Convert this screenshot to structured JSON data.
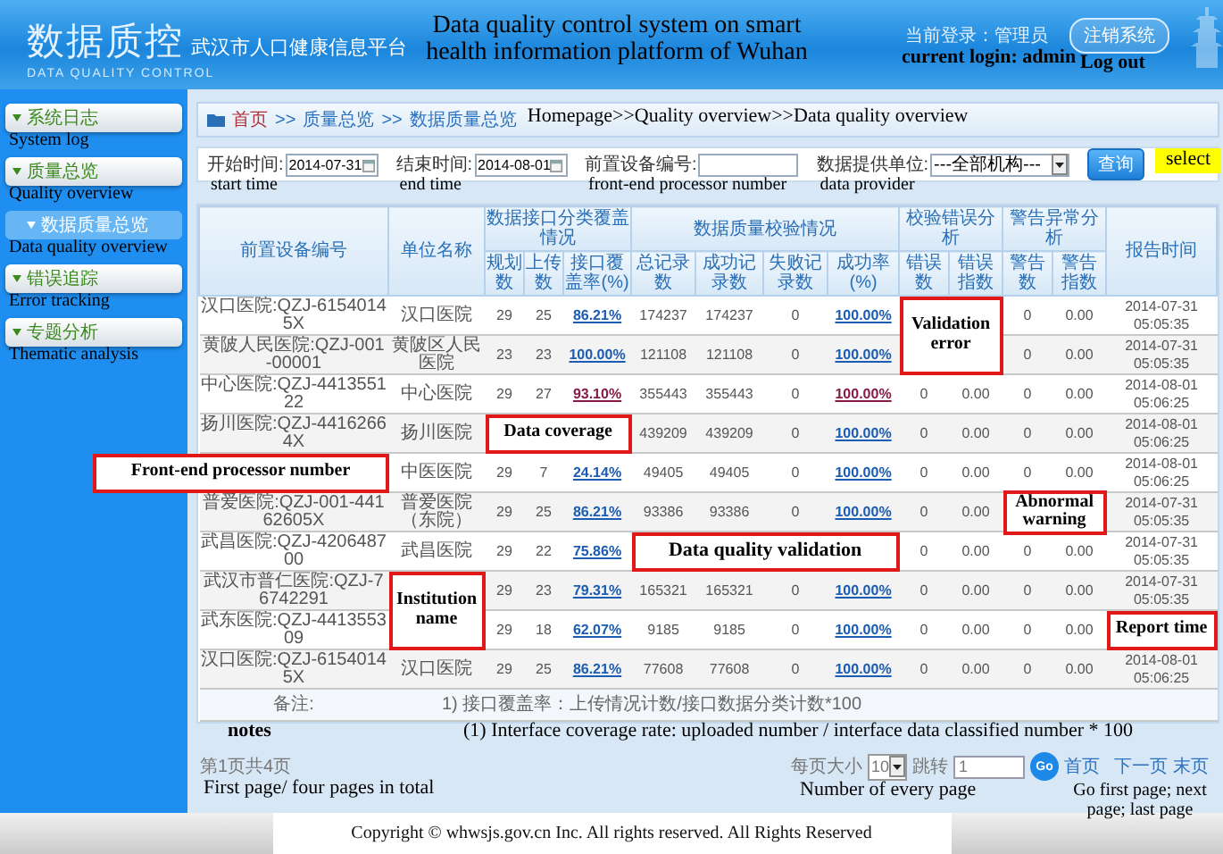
{
  "header": {
    "logo_title": "数据质控",
    "platform": "武汉市人口健康信息平台",
    "logo_subtitle": "DATA QUALITY CONTROL",
    "current_login": "当前登录：管理员",
    "logout": "注销系统"
  },
  "sidebar": {
    "items": [
      {
        "label": "系统日志",
        "selected": false
      },
      {
        "label": "质量总览",
        "selected": false,
        "children": [
          {
            "label": "数据质量总览",
            "selected": true
          }
        ]
      },
      {
        "label": "错误追踪",
        "selected": false
      },
      {
        "label": "专题分析",
        "selected": false
      }
    ]
  },
  "breadcrumb": {
    "items": [
      "首页",
      "质量总览",
      "数据质量总览"
    ],
    "separator": ">>"
  },
  "filters": [
    {
      "label": "开始时间:",
      "value": "2014-07-31",
      "kind": "date"
    },
    {
      "label": "结束时间:",
      "value": "2014-08-01",
      "kind": "date"
    },
    {
      "label": "前置设备编号:",
      "kind": "text"
    },
    {
      "label": "数据提供单位:",
      "value": "---全部机构---",
      "kind": "select"
    }
  ],
  "query_button": "查询",
  "table": {
    "header": [
      {
        "label": "前置设备编号"
      },
      {
        "label": "单位名称"
      },
      {
        "label": "数据接口分类覆盖情况",
        "sub": [
          "规划数",
          "上传数",
          "接口覆盖率(%)"
        ]
      },
      {
        "label": "数据质量校验情况",
        "sub": [
          "总记录数",
          "成功记录数",
          "失败记录数",
          "成功率(%)"
        ]
      },
      {
        "label": "校验错误分析",
        "sub": [
          "错误数",
          "错误指数"
        ]
      },
      {
        "label": "警告异常分析",
        "sub": [
          "警告数",
          "警告指数"
        ]
      },
      {
        "label": "报告时间"
      }
    ],
    "rows": [
      {
        "visited": false,
        "cells": [
          "汉口医院:QZJ-61540145X",
          "汉口医院",
          "29",
          "25",
          "86.21%",
          "174237",
          "174237",
          "0",
          "100.00%",
          null,
          null,
          "0",
          "0.00",
          "2014-07-31 05:05:35"
        ]
      },
      {
        "visited": false,
        "cells": [
          "黄陂人民医院:QZJ-001-00001",
          "黄陂区人民医院",
          "23",
          "23",
          "100.00%",
          "121108",
          "121108",
          "0",
          "100.00%",
          null,
          null,
          "0",
          "0.00",
          "2014-07-31 05:05:35"
        ]
      },
      {
        "visited": true,
        "cells": [
          "中心医院:QZJ-441355122",
          "中心医院",
          "29",
          "27",
          "93.10%",
          "355443",
          "355443",
          "0",
          "100.00%",
          "0",
          "0.00",
          "0",
          "0.00",
          "2014-08-01 05:06:25"
        ]
      },
      {
        "visited": false,
        "cells": [
          "扬川医院:QZJ-44162664X",
          "扬川医院",
          null,
          null,
          null,
          "439209",
          "439209",
          "0",
          "100.00%",
          "0",
          "0.00",
          "0",
          "0.00",
          "2014-08-01 05:06:25"
        ]
      },
      {
        "visited": false,
        "cells": [
          null,
          "中医医院",
          "29",
          "7",
          "24.14%",
          "49405",
          "49405",
          "0",
          "100.00%",
          "0",
          "0.00",
          "0",
          "0.00",
          "2014-08-01 05:06:25"
        ]
      },
      {
        "visited": false,
        "cells": [
          "普爱医院:QZJ-001-44162605X",
          "普爱医院（东院）",
          "29",
          "25",
          "86.21%",
          "93386",
          "93386",
          "0",
          "100.00%",
          "0",
          "0.00",
          null,
          null,
          "2014-07-31 05:05:35"
        ]
      },
      {
        "visited": false,
        "cells": [
          "武昌医院:QZJ-420648700",
          "武昌医院",
          "29",
          "22",
          "75.86%",
          null,
          null,
          null,
          null,
          "0",
          "0.00",
          "0",
          "0.00",
          "2014-07-31 05:05:35"
        ]
      },
      {
        "visited": false,
        "cells": [
          "武汉市普仁医院:QZJ-76742291",
          null,
          "29",
          "23",
          "79.31%",
          "165321",
          "165321",
          "0",
          "100.00%",
          "0",
          "0.00",
          "0",
          "0.00",
          "2014-07-31 05:05:35"
        ]
      },
      {
        "visited": false,
        "cells": [
          "武东医院:QZJ-441355309",
          null,
          "29",
          "18",
          "62.07%",
          "9185",
          "9185",
          "0",
          "100.00%",
          "0",
          "0.00",
          "0",
          "0.00",
          null
        ]
      },
      {
        "visited": false,
        "cells": [
          "汉口医院:QZJ-61540145X",
          "汉口医院",
          "29",
          "25",
          "86.21%",
          "77608",
          "77608",
          "0",
          "100.00%",
          "0",
          "0.00",
          "0",
          "0.00",
          "2014-08-01 05:06:25"
        ]
      }
    ],
    "notes_label": "备注:",
    "notes_text": "1) 接口覆盖率：上传情况计数/接口数据分类计数*100"
  },
  "pager": {
    "page_info": "第1页共4页",
    "page_size_label": "每页大小",
    "page_size": "10",
    "jump_label": "跳转",
    "jump_value": "1",
    "go": "Go",
    "links": [
      "首页",
      "下一页",
      "末页"
    ]
  },
  "annotations": [
    {
      "text": "Data quality control system on smart health information platform of Wuhan",
      "kind": "label"
    },
    {
      "text": "current login: admin",
      "kind": "label"
    },
    {
      "text": "Log out",
      "kind": "label"
    },
    {
      "text": "System log",
      "kind": "label"
    },
    {
      "text": "Quality overview",
      "kind": "label"
    },
    {
      "text": "Homepage>>Quality overview>>Data quality overview",
      "kind": "label"
    },
    {
      "text": "start time",
      "kind": "label"
    },
    {
      "text": "end time",
      "kind": "label"
    },
    {
      "text": "front-end processor number",
      "kind": "label"
    },
    {
      "text": "data provider",
      "kind": "label"
    },
    {
      "text": "select",
      "kind": "highlight"
    },
    {
      "text": "Data quality overview",
      "kind": "label"
    },
    {
      "text": "Error tracking",
      "kind": "label"
    },
    {
      "text": "Thematic analysis",
      "kind": "label"
    },
    {
      "text": "Validation error",
      "kind": "boxed"
    },
    {
      "text": "Data coverage",
      "kind": "boxed"
    },
    {
      "text": "Front-end processor number",
      "kind": "boxed"
    },
    {
      "text": "Abnormal warning",
      "kind": "boxed"
    },
    {
      "text": "Data quality validation",
      "kind": "boxed"
    },
    {
      "text": "Institution name",
      "kind": "boxed"
    },
    {
      "text": "Report time",
      "kind": "boxed"
    },
    {
      "text": "notes",
      "kind": "label"
    },
    {
      "text": "(1) Interface coverage rate: uploaded number / interface data classified number * 100",
      "kind": "label"
    },
    {
      "text": "First page/ four pages in total",
      "kind": "label"
    },
    {
      "text": "Number of every page",
      "kind": "label"
    },
    {
      "text": "Go first page; next page; last page",
      "kind": "label"
    }
  ],
  "footer": {
    "copyright": "Copyright © whwsjs.gov.cn Inc. All rights reserved. All Rights Reserved"
  }
}
